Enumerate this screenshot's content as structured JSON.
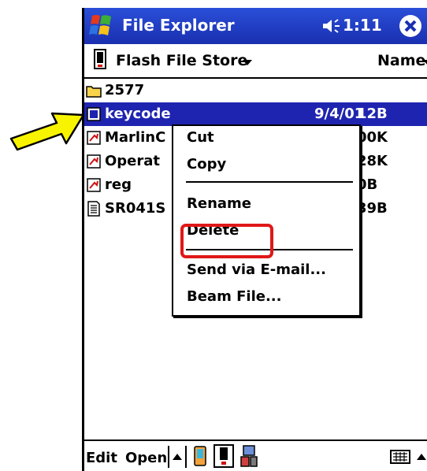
{
  "window": {
    "title": "File Explorer",
    "time": "1:11"
  },
  "location": {
    "store": "Flash File Store",
    "sort": "Name"
  },
  "files": [
    {
      "name": "2577",
      "icon": "folder-icon",
      "date": "",
      "size": "",
      "selected": false
    },
    {
      "name": "keycode",
      "icon": "file-icon",
      "date": "9/4/01",
      "size": "12B",
      "selected": true
    },
    {
      "name": "MarlinC",
      "icon": "shortcut-icon",
      "date": "",
      "size": "00K",
      "selected": false
    },
    {
      "name": "Operat",
      "icon": "shortcut-icon",
      "date": "",
      "size": "28K",
      "selected": false
    },
    {
      "name": "reg",
      "icon": "shortcut-icon",
      "date": "",
      "size": "0B",
      "selected": false
    },
    {
      "name": "SR041S",
      "icon": "document-icon",
      "date": "",
      "size": "39B",
      "selected": false
    }
  ],
  "context_menu": {
    "items": [
      "Cut",
      "Copy",
      "Rename",
      "Delete",
      "Send via E-mail...",
      "Beam File..."
    ]
  },
  "command_bar": {
    "edit": "Edit",
    "open": "Open"
  },
  "colors": {
    "titlebar": "#1a2fb0",
    "selection": "#1f24b0",
    "highlight": "#e01818",
    "arrow": "#f8f400"
  }
}
